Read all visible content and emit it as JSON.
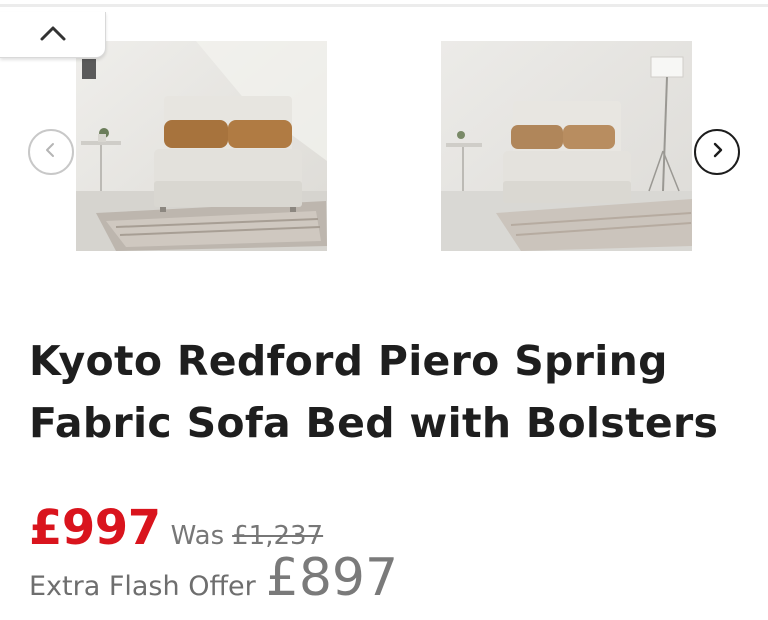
{
  "carousel": {
    "images": [
      {
        "alt": "sofa-bed-room-view-1"
      },
      {
        "alt": "sofa-bed-room-view-2"
      }
    ]
  },
  "product": {
    "title": "Kyoto Redford Piero Spring Fabric Sofa Bed with Bolsters"
  },
  "pricing": {
    "current_price": "£997",
    "was_label": "Was",
    "was_price": "£1,237",
    "offer_label": "Extra Flash Offer",
    "offer_price": "£897"
  },
  "colors": {
    "sale_red": "#d9141d",
    "text_dark": "#1e1e1e",
    "text_grey": "#777777"
  }
}
